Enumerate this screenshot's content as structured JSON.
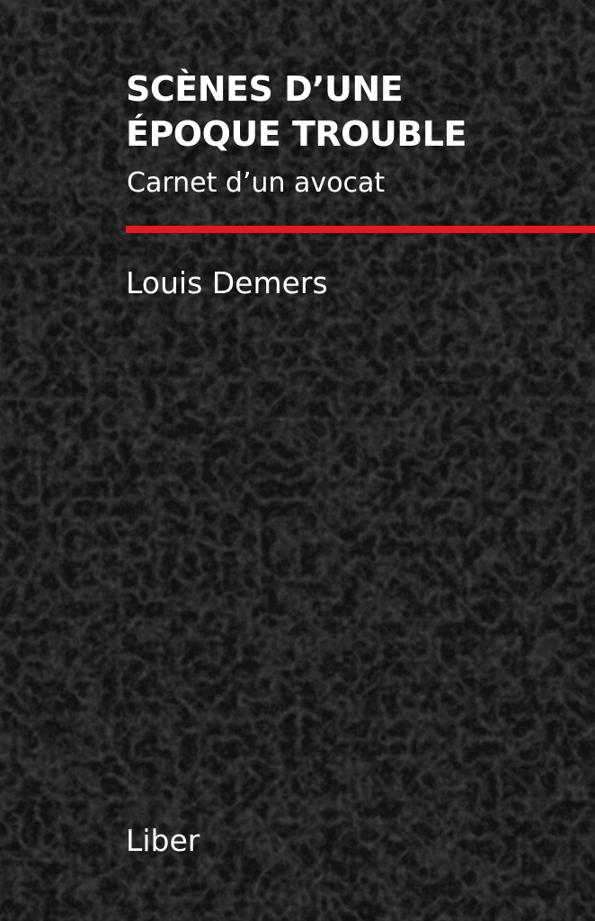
{
  "cover": {
    "title_line_1": "SCÈNES D’UNE",
    "title_line_2": "ÉPOQUE TROUBLE",
    "subtitle": "Carnet d’un avocat",
    "author": "Louis Demers",
    "publisher": "Liber"
  },
  "colors": {
    "background": "#121212",
    "accent_rule": "#e8181e",
    "text": "#ffffff"
  }
}
